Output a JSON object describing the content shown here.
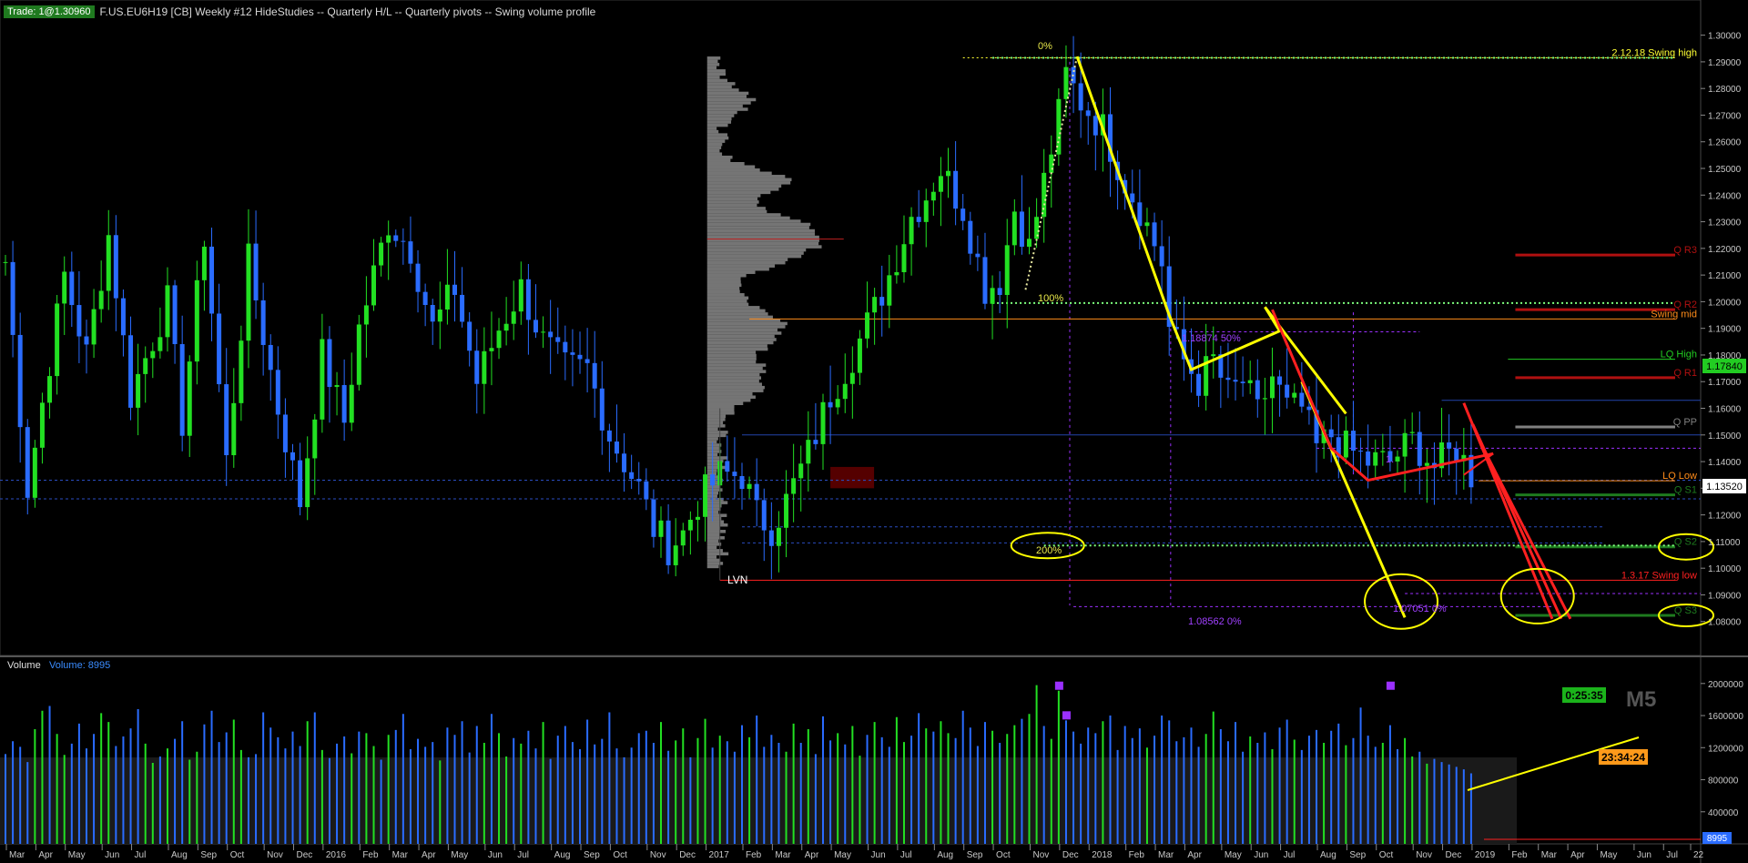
{
  "header": {
    "trade_badge": "Trade: 1@1.30960",
    "title": "F.US.EU6H19 [CB]  Weekly  #12 HideStudies  -- Quarterly H/L  -- Quarterly pivots  -- Swing volume profile"
  },
  "colors": {
    "background": "#000000",
    "up_candle": "#22e022",
    "down_candle": "#2a6cff",
    "annotation_yellow": "#ffff00",
    "annotation_red": "#ff2020",
    "fib_purple": "#9b30ff",
    "volume_profile": "#8a8a8a",
    "axis_text": "#c8c8c8"
  },
  "volume_panel": {
    "label": "Volume",
    "value_label": "Volume: 8995",
    "current_value": "8995"
  },
  "timers": {
    "countdown_1": "0:25:35",
    "countdown_2": "23:34:24",
    "timeframe_badge": "M5"
  },
  "chart_data": [
    {
      "type": "candlestick",
      "title": "",
      "ylabel": "",
      "ylim": [
        1.07,
        1.305
      ],
      "y_ticks": [
        "1.30000",
        "1.29000",
        "1.28000",
        "1.27000",
        "1.26000",
        "1.25000",
        "1.24000",
        "1.23000",
        "1.22000",
        "1.21000",
        "1.20000",
        "1.19000",
        "1.18000",
        "1.17000",
        "1.16000",
        "1.15000",
        "1.14000",
        "1.13000",
        "1.12000",
        "1.11000",
        "1.10000",
        "1.09000",
        "1.08000"
      ],
      "x_ticks": [
        "Mar",
        "Apr",
        "May",
        "Jun",
        "Jul",
        "Aug",
        "Sep",
        "Oct",
        "Nov",
        "Dec",
        "2016",
        "Feb",
        "Mar",
        "Apr",
        "May",
        "Jun",
        "Jul",
        "Aug",
        "Sep",
        "Oct",
        "Nov",
        "Dec",
        "2017",
        "Feb",
        "Mar",
        "Apr",
        "May",
        "Jun",
        "Jul",
        "Aug",
        "Sep",
        "Oct",
        "Nov",
        "Dec",
        "2018",
        "Feb",
        "Mar",
        "Apr",
        "May",
        "Jun",
        "Jul",
        "Aug",
        "Sep",
        "Oct",
        "Nov",
        "Dec",
        "2019",
        "Feb",
        "Mar",
        "Apr",
        "May",
        "Jun",
        "Jul",
        "22"
      ],
      "x_tick_positions_weeks": [
        0,
        4,
        8,
        13,
        17,
        22,
        26,
        30,
        35,
        39,
        43,
        48,
        52,
        56,
        60,
        65,
        69,
        74,
        78,
        82,
        87,
        91,
        95,
        100,
        104,
        108,
        112,
        117,
        121,
        126,
        130,
        134,
        139,
        143,
        147,
        152,
        156,
        160,
        165,
        169,
        173,
        178,
        182,
        186,
        191,
        195,
        199,
        204,
        208,
        212,
        216,
        221,
        225,
        229
      ],
      "anchors_weeks": [
        [
          0,
          1.215
        ],
        [
          3,
          1.13
        ],
        [
          8,
          1.21
        ],
        [
          11,
          1.18
        ],
        [
          14,
          1.225
        ],
        [
          17,
          1.165
        ],
        [
          22,
          1.2
        ],
        [
          24,
          1.155
        ],
        [
          27,
          1.225
        ],
        [
          30,
          1.14
        ],
        [
          33,
          1.215
        ],
        [
          37,
          1.16
        ],
        [
          40,
          1.125
        ],
        [
          43,
          1.18
        ],
        [
          46,
          1.155
        ],
        [
          48,
          1.19
        ],
        [
          52,
          1.23
        ],
        [
          55,
          1.22
        ],
        [
          58,
          1.19
        ],
        [
          61,
          1.205
        ],
        [
          64,
          1.17
        ],
        [
          67,
          1.19
        ],
        [
          70,
          1.205
        ],
        [
          73,
          1.185
        ],
        [
          76,
          1.175
        ],
        [
          79,
          1.175
        ],
        [
          82,
          1.15
        ],
        [
          84,
          1.14
        ],
        [
          86,
          1.13
        ],
        [
          88,
          1.115
        ],
        [
          90,
          1.108
        ],
        [
          92,
          1.113
        ],
        [
          94,
          1.125
        ],
        [
          97,
          1.135
        ],
        [
          100,
          1.135
        ],
        [
          102,
          1.12
        ],
        [
          104,
          1.115
        ],
        [
          106,
          1.125
        ],
        [
          109,
          1.143
        ],
        [
          112,
          1.165
        ],
        [
          115,
          1.18
        ],
        [
          118,
          1.197
        ],
        [
          120,
          1.21
        ],
        [
          123,
          1.232
        ],
        [
          125,
          1.24
        ],
        [
          127,
          1.25
        ],
        [
          130,
          1.235
        ],
        [
          133,
          1.205
        ],
        [
          135,
          1.208
        ],
        [
          137,
          1.235
        ],
        [
          139,
          1.22
        ],
        [
          141,
          1.245
        ],
        [
          143,
          1.27
        ],
        [
          144,
          1.285
        ],
        [
          146,
          1.275
        ],
        [
          149,
          1.265
        ],
        [
          152,
          1.245
        ],
        [
          154,
          1.235
        ],
        [
          157,
          1.215
        ],
        [
          158,
          1.19
        ],
        [
          160,
          1.178
        ],
        [
          162,
          1.17
        ],
        [
          164,
          1.178
        ],
        [
          166,
          1.165
        ],
        [
          168,
          1.17
        ],
        [
          170,
          1.158
        ],
        [
          172,
          1.172
        ],
        [
          174,
          1.16
        ],
        [
          176,
          1.16
        ],
        [
          178,
          1.145
        ],
        [
          180,
          1.15
        ],
        [
          182,
          1.145
        ],
        [
          185,
          1.14
        ],
        [
          188,
          1.14
        ],
        [
          191,
          1.148
        ],
        [
          194,
          1.138
        ],
        [
          197,
          1.145
        ],
        [
          199,
          1.135
        ]
      ]
    },
    {
      "type": "bar",
      "title": "",
      "ylim": [
        0,
        2100000
      ],
      "y_ticks": [
        "2000000",
        "1600000",
        "1200000",
        "800000",
        "400000"
      ],
      "series": [
        {
          "values_description_free": true,
          "values": [
            1120000,
            1280000,
            1210000,
            1020000,
            1430000,
            1660000,
            1720000,
            1370000,
            1110000,
            1250000,
            1500000,
            1190000,
            1370000,
            1630000,
            1520000,
            1220000,
            1340000,
            1440000,
            1680000,
            1250000,
            1010000,
            1090000,
            1190000,
            1310000,
            1530000,
            1050000,
            1150000,
            1490000,
            1660000,
            1270000,
            1390000,
            1550000,
            1170000,
            1080000,
            1120000,
            1640000,
            1450000,
            1330000,
            1190000,
            1400000,
            1220000,
            1530000,
            1640000,
            1170000,
            1070000,
            1250000,
            1340000,
            1130000,
            1400000,
            1380000,
            1220000,
            1050000,
            1360000,
            1420000,
            1620000,
            1180000,
            1310000,
            1210000,
            1270000,
            1040000,
            1450000,
            1360000,
            1530000,
            1140000,
            1470000,
            1260000,
            1620000,
            1380000,
            1090000,
            1320000,
            1250000,
            1410000,
            1190000,
            1520000,
            1060000,
            1350000,
            1470000,
            1270000,
            1180000,
            1550000,
            1240000,
            1310000,
            1640000,
            1190000,
            1080000,
            1200000,
            1380000,
            1410000,
            1260000,
            1520000,
            1160000,
            1290000,
            1440000,
            1080000,
            1320000,
            1560000,
            1200000,
            1350000,
            1280000,
            1150000,
            1480000,
            1330000,
            1600000,
            1210000,
            1360000,
            1260000,
            1150000,
            1500000,
            1260000,
            1430000,
            1120000,
            1590000,
            1290000,
            1380000,
            1240000,
            1470000,
            1100000,
            1360000,
            1520000,
            1330000,
            1210000,
            1580000,
            1270000,
            1350000,
            1630000,
            1440000,
            1400000,
            1530000,
            1380000,
            1320000,
            1660000,
            1450000,
            1220000,
            1520000,
            1410000,
            1260000,
            1370000,
            1480000,
            1560000,
            1620000,
            1980000,
            1470000,
            1310000,
            1910000,
            1540000,
            1400000,
            1250000,
            1450000,
            1380000,
            1530000,
            1600000,
            1170000,
            1470000,
            1320000,
            1440000,
            1200000,
            1350000,
            1600000,
            1540000,
            1280000,
            1330000,
            1450000,
            1210000,
            1370000,
            1650000,
            1430000,
            1280000,
            1520000,
            1150000,
            1340000,
            1260000,
            1390000,
            1180000,
            1450000,
            1550000,
            1300000,
            1170000,
            1350000,
            1420000,
            1260000,
            1410000,
            1500000,
            1230000,
            1320000,
            1700000,
            1350000,
            1210000,
            1260000,
            1480000,
            1180000,
            1320000,
            1090000,
            1150000,
            1000000,
            1060000,
            1020000,
            990000,
            960000,
            930000,
            880000
          ]
        }
      ],
      "highlight_bars": [
        143,
        144
      ]
    }
  ],
  "price_levels": [
    {
      "label": "2.12.18 Swing high",
      "price": 1.2915,
      "color": "#ffff33"
    },
    {
      "label": "Q R3",
      "price": 1.2175,
      "color": "#b01010"
    },
    {
      "label": "Q R2",
      "price": 1.197,
      "color": "#b01010"
    },
    {
      "label": "Swing mid",
      "price": 1.1935,
      "color": "#ff8c1a"
    },
    {
      "label": "LQ High",
      "price": 1.1784,
      "value": "1.17840",
      "color": "#22cc22"
    },
    {
      "label": "Q R1",
      "price": 1.1715,
      "color": "#b01010"
    },
    {
      "label": "Q PP",
      "price": 1.153,
      "color": "#808080"
    },
    {
      "label": "LQ Low",
      "price": 1.1328,
      "color": "#ff8c1a"
    },
    {
      "label": "Q S1",
      "price": 1.1275,
      "color": "#1e7a1e"
    },
    {
      "label": "Q S2",
      "price": 1.108,
      "color": "#1e7a1e"
    },
    {
      "label": "1.3.17 Swing low",
      "price": 1.0955,
      "color": "#ff2020"
    },
    {
      "label": "Q S3",
      "price": 1.0823,
      "color": "#1e7a1e"
    }
  ],
  "last_price": "1.13520",
  "fib": {
    "zero_pct": "0%",
    "hundred_pct": "100%",
    "two_hundred_pct": "200%",
    "fifty_label": "1.18874 50%",
    "level_zero_a": "1.08562 0%",
    "level_zero_b": "1.07051 0%",
    "partial_label": "1."
  },
  "profile_label": "LVN"
}
